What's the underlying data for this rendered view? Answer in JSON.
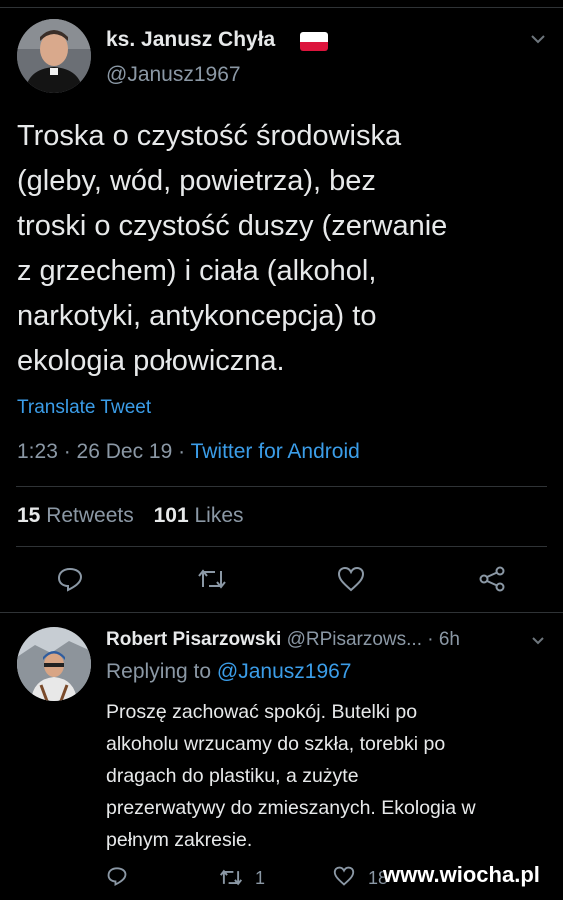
{
  "tweet": {
    "author_name": "ks. Janusz Chyła",
    "handle": "@Janusz1967",
    "text_lines": [
      "Troska o czystość środowiska",
      "(gleby, wód, powietrza), bez",
      "troski o czystość duszy (zerwanie",
      "z grzechem) i ciała (alkohol,",
      "narkotyki, antykoncepcja) to",
      "ekologia połowiczna."
    ],
    "translate": "Translate Tweet",
    "time": "1:23 · 26 Dec 19 · ",
    "source": "Twitter for Android",
    "retweets_count": "15",
    "retweets_label": "Retweets",
    "likes_count": "101",
    "likes_label": "Likes"
  },
  "reply": {
    "author_name": "Robert Pisarzowski",
    "handle_time": "@RPisarzows... · 6h",
    "replying_prefix": "Replying to ",
    "replying_handle": "@Janusz1967",
    "text_lines": [
      "Proszę zachować spokój. Butelki po",
      "alkoholu wrzucamy do szkła, torebki po",
      "dragach do plastiku, a zużyte",
      "prezerwatywy do zmieszanych. Ekologia w",
      "pełnym zakresie."
    ],
    "retweet_count": "1",
    "like_count": "18"
  },
  "watermark": "www.wiocha.pl",
  "colors": {
    "background": "#000000",
    "link": "#3b9de8",
    "muted": "#8b98a5",
    "divider": "#2f3336"
  }
}
